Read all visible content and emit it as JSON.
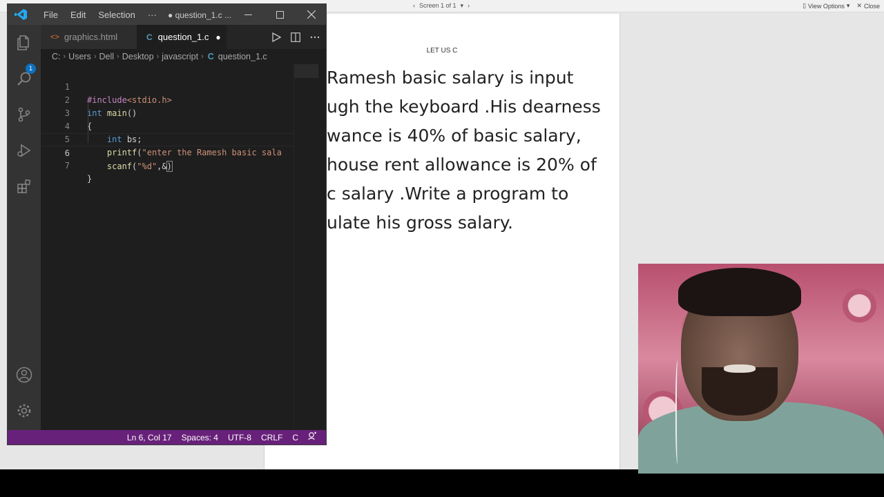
{
  "reader": {
    "nav_label": "Screen 1 of 1",
    "view_options": "View Options",
    "close": "Close",
    "page_header": "LET US C",
    "page_lines": [
      "Ramesh basic salary is input",
      "ugh the keyboard .His dearness",
      "wance is 40% of basic salary,",
      "house rent allowance is 20% of",
      "c salary .Write a program to",
      "ulate his gross  salary."
    ]
  },
  "vscode": {
    "menu": [
      "File",
      "Edit",
      "Selection",
      "···"
    ],
    "window_title": "● question_1.c ...",
    "explorer_badge": "1",
    "tabs": [
      {
        "label": "graphics.html",
        "icon": "html-file-icon"
      },
      {
        "label": "question_1.c",
        "icon": "c-file-icon",
        "modified": "●"
      }
    ],
    "breadcrumb": [
      "C:",
      "Users",
      "Dell",
      "Desktop",
      "javascript",
      "question_1.c"
    ],
    "breadcrumb_file_icon": "C",
    "code_lines": [
      {
        "n": "1",
        "text": "#include<stdio.h>"
      },
      {
        "n": "2",
        "text": "int main()"
      },
      {
        "n": "3",
        "text": "{"
      },
      {
        "n": "4",
        "text": "    int bs;"
      },
      {
        "n": "5",
        "text": "    printf(\"enter the Ramesh basic sala"
      },
      {
        "n": "6",
        "text": "    scanf(\"%d\",&)"
      },
      {
        "n": "7",
        "text": "}"
      }
    ],
    "status": {
      "position": "Ln 6, Col 17",
      "spaces": "Spaces: 4",
      "encoding": "UTF-8",
      "eol": "CRLF",
      "language": "C"
    },
    "colors": {
      "statusbar": "#68217a",
      "editor_bg": "#1e1e1e",
      "activitybar": "#333333"
    }
  }
}
